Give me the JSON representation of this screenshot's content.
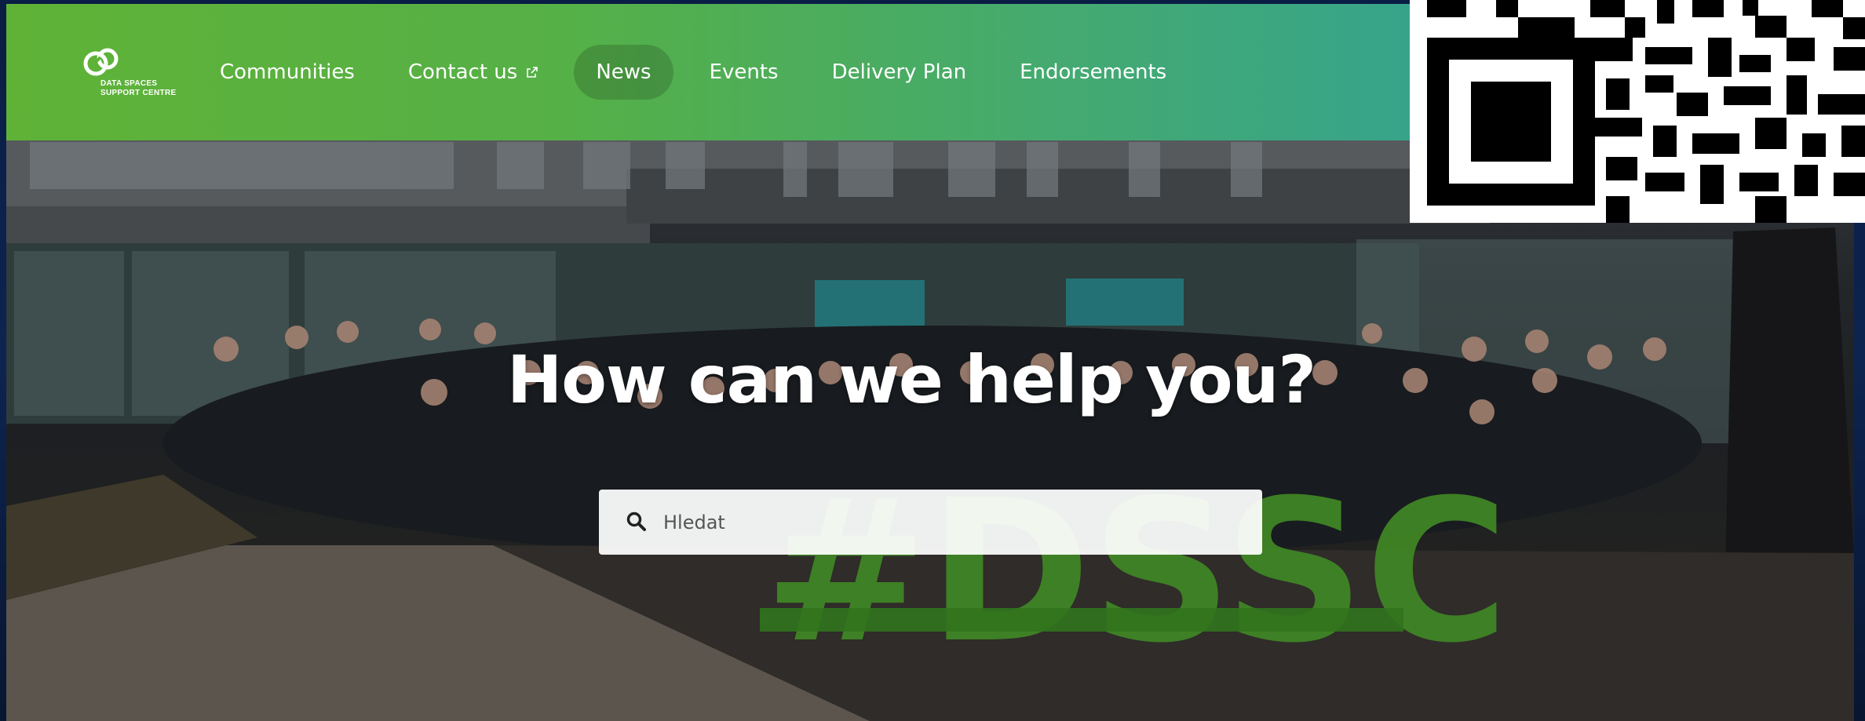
{
  "logo": {
    "text_line1": "DATA SPACES",
    "text_line2": "SUPPORT CENTRE",
    "icon": "dssc-logo-icon"
  },
  "nav": {
    "items": [
      {
        "label": "Communities"
      },
      {
        "label": "Contact us",
        "icon": "external-link-icon"
      },
      {
        "label": "News",
        "active": true
      },
      {
        "label": "Events"
      },
      {
        "label": "Delivery Plan"
      },
      {
        "label": "Endorsements"
      }
    ]
  },
  "hero": {
    "title": "How can we help you?",
    "backdrop_lettering": "#DSSC"
  },
  "search": {
    "placeholder": "Hledat",
    "value": "",
    "icon": "search-icon"
  },
  "colors": {
    "header_left": "#5fb236",
    "header_right": "#37a48a",
    "nav_text": "#ffffff",
    "sign_green": "#4ea32e"
  }
}
